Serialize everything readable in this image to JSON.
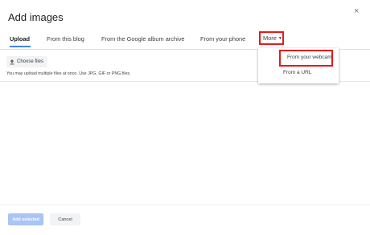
{
  "dialog": {
    "title": "Add images",
    "close_glyph": "×"
  },
  "tabs": [
    {
      "label": "Upload",
      "active": true
    },
    {
      "label": "From this blog"
    },
    {
      "label": "From the Google album archive"
    },
    {
      "label": "From your phone"
    }
  ],
  "more_tab": {
    "label": "More",
    "caret": "▼"
  },
  "upload": {
    "choose_files_label": "Choose files",
    "hint": "You may upload multiple files at once. Use JPG, GIF or PNG files."
  },
  "menu": {
    "items": [
      {
        "label": "From your webcam",
        "highlighted": true
      },
      {
        "label": "From a URL"
      }
    ]
  },
  "footer": {
    "add_selected_label": "Add selected",
    "cancel_label": "Cancel"
  },
  "colors": {
    "accent": "#4285f4",
    "highlight_border": "#e21b1b",
    "disabled_button": "#a9c4f5"
  },
  "icons": {
    "close": "close-icon",
    "upload": "upload-icon",
    "caret": "caret-down-icon"
  }
}
